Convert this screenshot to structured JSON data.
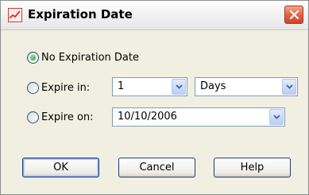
{
  "window": {
    "title": "Expiration Date",
    "icon": "chart-app-icon",
    "close_icon": "close-icon"
  },
  "options": [
    {
      "id": "no-expiration",
      "label": "No Expiration Date",
      "selected": true
    },
    {
      "id": "expire-in",
      "label": "Expire in:",
      "selected": false
    },
    {
      "id": "expire-on",
      "label": "Expire on:",
      "selected": false
    }
  ],
  "expire_in": {
    "amount": "1",
    "unit": "Days"
  },
  "expire_on": {
    "date": "10/10/2006"
  },
  "buttons": {
    "ok": "OK",
    "cancel": "Cancel",
    "help": "Help"
  },
  "colors": {
    "close_button": "#e06548",
    "radio_selected_dot": "#21a121",
    "dropdown_button": "#b9cdf6"
  }
}
